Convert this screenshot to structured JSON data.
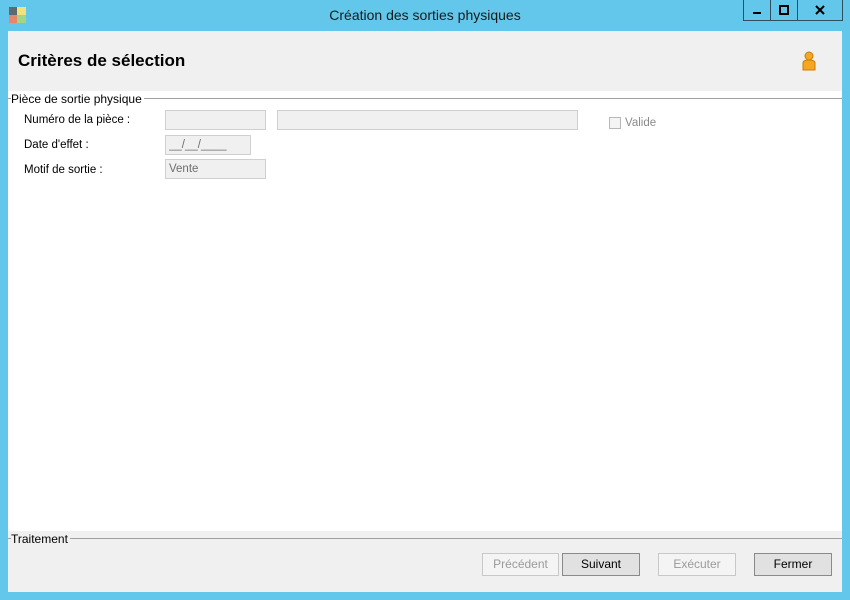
{
  "window": {
    "title": "Création des sorties physiques",
    "controls": {
      "minimize": "▁",
      "maximize": "□",
      "close": "✕"
    },
    "colors": {
      "frame": "#62c7ea"
    }
  },
  "header": {
    "title": "Critères de sélection",
    "icon": "user-icon"
  },
  "groups": {
    "piece": {
      "title": "Pièce de sortie physique",
      "fields": {
        "numero_label": "Numéro de la pièce :",
        "numero_value": "",
        "numero_desc_value": "",
        "date_label": "Date d'effet :",
        "date_value": "__/__/____",
        "motif_label": "Motif de sortie :",
        "motif_value": "Vente"
      },
      "valide_label": "Valide",
      "valide_checked": false
    },
    "traitement": {
      "title": "Traitement"
    }
  },
  "buttons": {
    "precedent": "Précédent",
    "suivant": "Suivant",
    "executer": "Exécuter",
    "fermer": "Fermer"
  }
}
